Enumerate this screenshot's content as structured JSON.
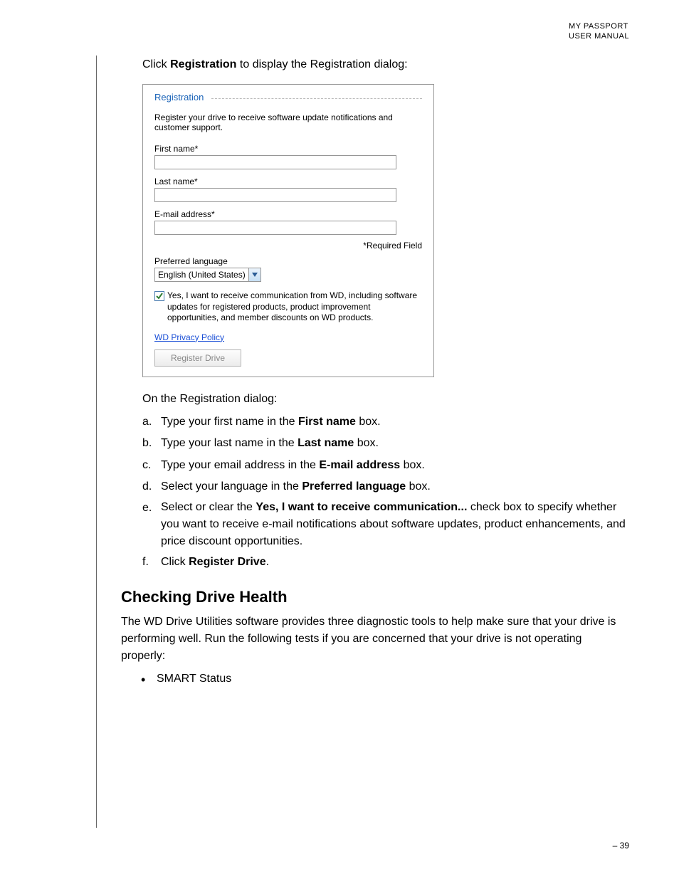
{
  "header": {
    "line1": "MY PASSPORT",
    "line2": "USER MANUAL"
  },
  "intro": {
    "prefix": "Click ",
    "bold": "Registration",
    "suffix": " to display the Registration dialog:"
  },
  "dialog": {
    "title": "Registration",
    "description": "Register your drive to receive software update notifications and customer support.",
    "first_name_label": "First name*",
    "last_name_label": "Last name*",
    "email_label": "E-mail address*",
    "required_note": "*Required Field",
    "language_label": "Preferred language",
    "language_value": "English (United States)",
    "checkbox_text": "Yes, I want to receive communication from WD, including software updates for registered products, product improvement opportunities, and member discounts on WD products.",
    "privacy_link": "WD Privacy Policy",
    "register_button": "Register Drive"
  },
  "after_dialog_text": "On the Registration dialog:",
  "steps": {
    "a": {
      "marker": "a.",
      "pre": "Type your first name in the ",
      "bold": "First name",
      "post": " box."
    },
    "b": {
      "marker": "b.",
      "pre": "Type your last name in the ",
      "bold": "Last name",
      "post": " box."
    },
    "c": {
      "marker": "c.",
      "pre": "Type your email address in the ",
      "bold": "E-mail address",
      "post": " box."
    },
    "d": {
      "marker": "d.",
      "pre": "Select your language in the ",
      "bold": "Preferred language",
      "post": " box."
    },
    "e": {
      "marker": "e.",
      "pre": "Select or clear the ",
      "bold": "Yes, I want to receive communication...",
      "post": " check box to specify whether you want to receive e-mail notifications about software updates, product enhancements, and price discount opportunities."
    },
    "f": {
      "marker": "f.",
      "pre": "Click ",
      "bold": "Register Drive",
      "post": "."
    }
  },
  "section": {
    "heading": "Checking Drive Health",
    "paragraph": "The WD Drive Utilities software provides three diagnostic tools to help make sure that your drive is performing well. Run the following tests if you are concerned that your drive is not operating properly:",
    "bullet1": "SMART Status"
  },
  "page_number": "– 39"
}
